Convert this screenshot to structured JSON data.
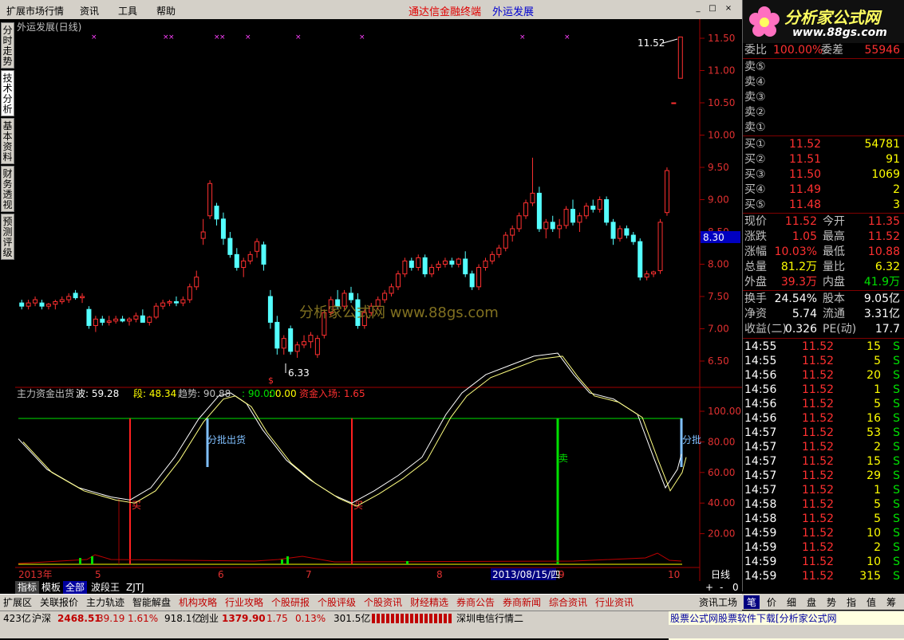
{
  "menu": [
    "扩展市场行情",
    "资讯",
    "工具",
    "帮助"
  ],
  "app_title": "通达信金融终端",
  "stock_name": "外运发展",
  "window_buttons": [
    "_",
    "□",
    "×"
  ],
  "left_tabs": [
    "分时走势",
    "技术分析",
    "基本资料",
    "财务透视",
    "预测评级"
  ],
  "chart_title": "外运发展(日线)",
  "price_axis": [
    "11.50",
    "11.00",
    "10.50",
    "10.00",
    "9.50",
    "9.00",
    "8.50",
    "8.00",
    "7.50",
    "7.00",
    "6.50"
  ],
  "current_price_tag": "8.30",
  "high_label": "11.52",
  "low_label": "6.33",
  "watermark": "分析家公式网 www.88gs.com",
  "indicator_header": {
    "name": "主力资金出货",
    "wave": "波: 59.28",
    "segment": "段: 48.34",
    "trend": "趋势: 90.88",
    "v1": ": 90.00",
    "v2": ": 0.00",
    "inflow": "资金入场: 1.65"
  },
  "indicator_axis": [
    "100.00",
    "80.00",
    "60.00",
    "40.00",
    "20.00"
  ],
  "signals": {
    "buy": "买",
    "sell": "卖",
    "batch_sell": "分批出货",
    "batch": "分批"
  },
  "time_axis": [
    "2013年",
    "5",
    "6",
    "7",
    "8",
    "2013/08/15/四",
    "9",
    "10"
  ],
  "period": "日线",
  "indicator_tabs": [
    "指标",
    "模板",
    "全部",
    "波段王",
    "ZJTJ"
  ],
  "bottom_tabs": [
    "扩展区",
    "关联报价",
    "主力轨迹",
    "智能解盘",
    "机构攻略",
    "行业攻略",
    "个股研报",
    "个股评级",
    "个股资讯",
    "财经精选",
    "券商公告",
    "券商新闻",
    "综合资讯",
    "行业资讯",
    "资讯工场"
  ],
  "panel_tabs": [
    "笔",
    "价",
    "细",
    "盘",
    "势",
    "指",
    "值",
    "筹"
  ],
  "logo": {
    "brand": "分析家公式网",
    "url": "www.88gs.com"
  },
  "quote": {
    "weibi_label": "委比",
    "weibi": "100.00%",
    "weicha_label": "委差",
    "weicha": "55946",
    "sell": [
      {
        "label": "卖⑤"
      },
      {
        "label": "卖④"
      },
      {
        "label": "卖③"
      },
      {
        "label": "卖②"
      },
      {
        "label": "卖①"
      }
    ],
    "buy": [
      {
        "label": "买①",
        "price": "11.52",
        "vol": "54781"
      },
      {
        "label": "买②",
        "price": "11.51",
        "vol": "91"
      },
      {
        "label": "买③",
        "price": "11.50",
        "vol": "1069"
      },
      {
        "label": "买④",
        "price": "11.49",
        "vol": "2"
      },
      {
        "label": "买⑤",
        "price": "11.48",
        "vol": "3"
      }
    ],
    "stats": [
      {
        "l1": "现价",
        "v1": "11.52",
        "l2": "今开",
        "v2": "11.35"
      },
      {
        "l1": "涨跌",
        "v1": "1.05",
        "l2": "最高",
        "v2": "11.52"
      },
      {
        "l1": "涨幅",
        "v1": "10.03%",
        "l2": "最低",
        "v2": "10.88"
      },
      {
        "l1": "总量",
        "v1": "81.2万",
        "l2": "量比",
        "v2": "6.32"
      },
      {
        "l1": "外盘",
        "v1": "39.3万",
        "l2": "内盘",
        "v2": "41.9万"
      }
    ],
    "stats2": [
      {
        "l1": "换手",
        "v1": "24.54%",
        "l2": "股本",
        "v2": "9.05亿"
      },
      {
        "l1": "净资",
        "v1": "5.74",
        "l2": "流通",
        "v2": "3.31亿"
      },
      {
        "l1": "收益(二)",
        "v1": "0.326",
        "l2": "PE(动)",
        "v2": "17.7"
      }
    ],
    "ticks": [
      {
        "t": "14:55",
        "p": "11.52",
        "v": "15",
        "s": "S"
      },
      {
        "t": "14:55",
        "p": "11.52",
        "v": "5",
        "s": "S"
      },
      {
        "t": "14:56",
        "p": "11.52",
        "v": "20",
        "s": "S"
      },
      {
        "t": "14:56",
        "p": "11.52",
        "v": "1",
        "s": "S"
      },
      {
        "t": "14:56",
        "p": "11.52",
        "v": "5",
        "s": "S"
      },
      {
        "t": "14:56",
        "p": "11.52",
        "v": "16",
        "s": "S"
      },
      {
        "t": "14:57",
        "p": "11.52",
        "v": "53",
        "s": "S"
      },
      {
        "t": "14:57",
        "p": "11.52",
        "v": "2",
        "s": "S"
      },
      {
        "t": "14:57",
        "p": "11.52",
        "v": "15",
        "s": "S"
      },
      {
        "t": "14:57",
        "p": "11.52",
        "v": "29",
        "s": "S"
      },
      {
        "t": "14:57",
        "p": "11.52",
        "v": "1",
        "s": "S"
      },
      {
        "t": "14:58",
        "p": "11.52",
        "v": "5",
        "s": "S"
      },
      {
        "t": "14:58",
        "p": "11.52",
        "v": "5",
        "s": "S"
      },
      {
        "t": "14:59",
        "p": "11.52",
        "v": "10",
        "s": "S"
      },
      {
        "t": "14:59",
        "p": "11.52",
        "v": "2",
        "s": "S"
      },
      {
        "t": "14:59",
        "p": "11.52",
        "v": "10",
        "s": "S"
      },
      {
        "t": "14:59",
        "p": "11.52",
        "v": "315",
        "s": "S"
      }
    ]
  },
  "status": {
    "s0": "423亿",
    "s1": "沪深",
    "s2": "2468.51",
    "s3": "39.19",
    "s4": "1.61%",
    "s5": "918.1亿",
    "s6": "创业",
    "s7": "1379.90",
    "s8": "1.75",
    "s9": "0.13%",
    "s10": "301.5亿",
    "s11": "深圳电信行情二",
    "ad": "股票公式网股票软件下载[分析家公式网www.88gs.com]"
  },
  "candles": [
    [
      7.4,
      7.45,
      7.3,
      7.35
    ],
    [
      7.35,
      7.45,
      7.3,
      7.4
    ],
    [
      7.4,
      7.5,
      7.35,
      7.45
    ],
    [
      7.4,
      7.45,
      7.3,
      7.35
    ],
    [
      7.35,
      7.4,
      7.3,
      7.38
    ],
    [
      7.38,
      7.45,
      7.3,
      7.42
    ],
    [
      7.42,
      7.5,
      7.38,
      7.45
    ],
    [
      7.45,
      7.55,
      7.4,
      7.5
    ],
    [
      7.55,
      7.6,
      7.45,
      7.48
    ],
    [
      7.48,
      7.55,
      7.4,
      7.5
    ],
    [
      7.3,
      7.35,
      7.0,
      7.05
    ],
    [
      7.05,
      7.2,
      6.95,
      7.15
    ],
    [
      7.15,
      7.2,
      7.05,
      7.1
    ],
    [
      7.1,
      7.2,
      7.05,
      7.12
    ],
    [
      7.12,
      7.2,
      7.08,
      7.15
    ],
    [
      7.15,
      7.2,
      7.1,
      7.12
    ],
    [
      7.12,
      7.18,
      7.05,
      7.15
    ],
    [
      7.15,
      7.25,
      7.1,
      7.2
    ],
    [
      7.2,
      7.3,
      7.1,
      7.1
    ],
    [
      7.1,
      7.2,
      7.05,
      7.18
    ],
    [
      7.18,
      7.4,
      7.15,
      7.35
    ],
    [
      7.35,
      7.45,
      7.3,
      7.4
    ],
    [
      7.4,
      7.45,
      7.35,
      7.42
    ],
    [
      7.42,
      7.5,
      7.35,
      7.4
    ],
    [
      7.4,
      7.5,
      7.35,
      7.45
    ],
    [
      7.45,
      7.7,
      7.4,
      7.65
    ],
    [
      7.65,
      7.9,
      7.6,
      7.8
    ],
    [
      8.4,
      8.7,
      8.3,
      8.5
    ],
    [
      8.75,
      9.3,
      8.7,
      9.25
    ],
    [
      8.9,
      8.95,
      8.6,
      8.7
    ],
    [
      8.7,
      8.8,
      8.3,
      8.4
    ],
    [
      8.4,
      8.5,
      8.1,
      8.15
    ],
    [
      8.15,
      8.25,
      7.9,
      7.95
    ],
    [
      7.95,
      8.1,
      7.8,
      8.05
    ],
    [
      8.05,
      8.2,
      8.0,
      8.15
    ],
    [
      8.2,
      8.4,
      8.1,
      8.35
    ],
    [
      8.3,
      8.35,
      7.9,
      8.0
    ],
    [
      7.5,
      7.6,
      7.0,
      7.1
    ],
    [
      7.1,
      7.2,
      6.6,
      6.7
    ],
    [
      6.7,
      6.9,
      6.6,
      6.85
    ],
    [
      7.0,
      7.05,
      6.6,
      6.65
    ],
    [
      6.65,
      6.8,
      6.55,
      6.75
    ],
    [
      6.75,
      6.9,
      6.7,
      6.8
    ],
    [
      6.8,
      6.95,
      6.7,
      6.9
    ],
    [
      6.6,
      6.9,
      6.55,
      6.85
    ],
    [
      6.9,
      7.3,
      6.85,
      7.25
    ],
    [
      7.25,
      7.5,
      7.2,
      7.45
    ],
    [
      7.45,
      7.6,
      7.3,
      7.35
    ],
    [
      7.35,
      7.6,
      7.3,
      7.55
    ],
    [
      7.55,
      7.65,
      7.4,
      7.45
    ],
    [
      7.45,
      7.55,
      7.0,
      7.05
    ],
    [
      7.05,
      7.3,
      7.0,
      7.25
    ],
    [
      7.25,
      7.4,
      7.2,
      7.35
    ],
    [
      7.35,
      7.5,
      7.3,
      7.45
    ],
    [
      7.45,
      7.6,
      7.4,
      7.55
    ],
    [
      7.55,
      7.7,
      7.5,
      7.65
    ],
    [
      7.65,
      7.9,
      7.6,
      7.85
    ],
    [
      7.85,
      8.1,
      7.8,
      8.05
    ],
    [
      8.05,
      8.1,
      7.9,
      7.95
    ],
    [
      7.95,
      8.15,
      7.9,
      8.1
    ],
    [
      8.1,
      8.15,
      7.8,
      7.85
    ],
    [
      7.85,
      8.0,
      7.8,
      7.95
    ],
    [
      7.95,
      8.05,
      7.9,
      8.0
    ],
    [
      8.0,
      8.1,
      7.95,
      8.05
    ],
    [
      8.05,
      8.1,
      7.95,
      8.0
    ],
    [
      8.0,
      8.1,
      7.95,
      8.08
    ],
    [
      8.08,
      8.2,
      7.8,
      7.85
    ],
    [
      7.85,
      7.9,
      7.6,
      7.65
    ],
    [
      7.65,
      8.0,
      7.6,
      7.95
    ],
    [
      7.95,
      8.1,
      7.9,
      8.05
    ],
    [
      8.05,
      8.2,
      8.0,
      8.15
    ],
    [
      8.15,
      8.3,
      8.1,
      8.25
    ],
    [
      8.25,
      8.5,
      8.2,
      8.45
    ],
    [
      8.45,
      8.6,
      8.35,
      8.55
    ],
    [
      8.55,
      8.8,
      8.5,
      8.75
    ],
    [
      8.75,
      9.0,
      8.7,
      8.95
    ],
    [
      8.95,
      9.65,
      8.9,
      9.1
    ],
    [
      9.1,
      9.2,
      8.5,
      8.55
    ],
    [
      8.55,
      8.7,
      8.4,
      8.65
    ],
    [
      8.65,
      8.75,
      8.5,
      8.55
    ],
    [
      8.55,
      8.7,
      8.4,
      8.6
    ],
    [
      8.6,
      8.9,
      8.55,
      8.85
    ],
    [
      8.85,
      9.0,
      8.6,
      8.65
    ],
    [
      8.65,
      8.8,
      8.5,
      8.75
    ],
    [
      8.75,
      8.95,
      8.7,
      8.9
    ],
    [
      8.9,
      9.0,
      8.8,
      8.85
    ],
    [
      8.85,
      9.05,
      8.8,
      9.0
    ],
    [
      9.0,
      9.05,
      8.6,
      8.65
    ],
    [
      8.65,
      8.7,
      8.3,
      8.4
    ],
    [
      8.4,
      8.6,
      8.35,
      8.55
    ],
    [
      8.55,
      8.6,
      8.4,
      8.45
    ],
    [
      8.45,
      8.5,
      8.3,
      8.35
    ],
    [
      8.35,
      8.4,
      7.75,
      7.8
    ],
    [
      7.8,
      7.9,
      7.75,
      7.85
    ],
    [
      7.85,
      7.9,
      7.8,
      7.88
    ],
    [
      7.9,
      8.7,
      7.85,
      8.65
    ],
    [
      8.8,
      9.5,
      8.75,
      9.45
    ],
    [
      10.5,
      10.5,
      10.5,
      10.5
    ],
    [
      10.88,
      11.52,
      10.88,
      11.52
    ]
  ]
}
